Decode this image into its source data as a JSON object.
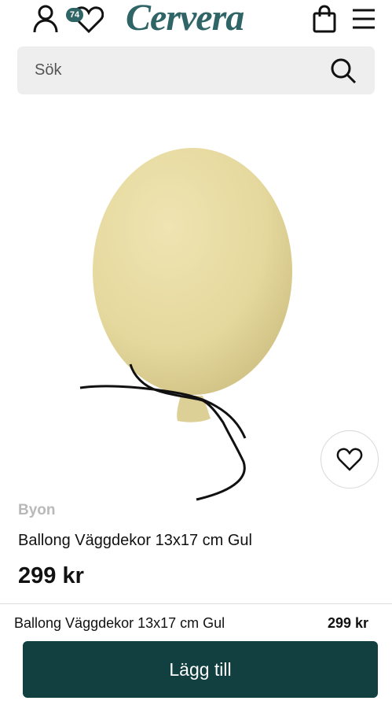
{
  "header": {
    "logo_text": "Cervera",
    "wishlist_count": "74",
    "icons": [
      "user-icon",
      "heart-icon",
      "shopping-bag-icon",
      "hamburger-menu-icon"
    ]
  },
  "search": {
    "placeholder": "Sök"
  },
  "product": {
    "brand": "Byon",
    "name": "Ballong Väggdekor 13x17 cm Gul",
    "price": "299 kr"
  },
  "sticky_bar": {
    "name": "Ballong Väggdekor 13x17 cm Gul",
    "price": "299 kr",
    "add_button_label": "Lägg till"
  },
  "colors": {
    "brand": "#2f6566",
    "button": "#123f3f",
    "balloon": "#e8dba4",
    "search_bg": "#eeeeef"
  }
}
